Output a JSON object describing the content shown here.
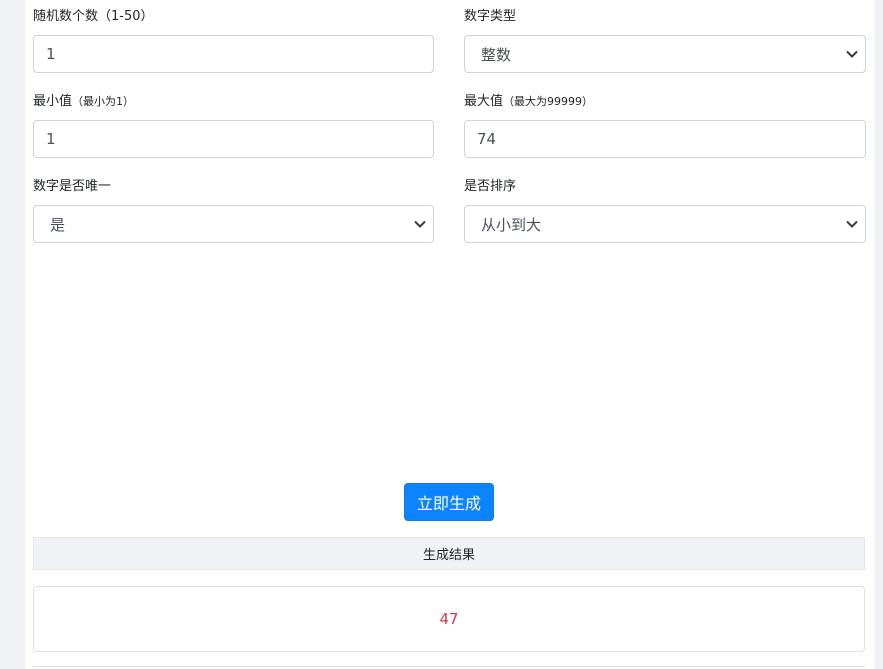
{
  "form": {
    "count": {
      "label": "随机数个数（1-50）",
      "value": "1"
    },
    "type": {
      "label": "数字类型",
      "value": "整数"
    },
    "min": {
      "label": "最小值",
      "hint": "（最小为1）",
      "value": "1"
    },
    "max": {
      "label": "最大值",
      "hint": "（最大为99999）",
      "value": "74"
    },
    "unique": {
      "label": "数字是否唯一",
      "value": "是"
    },
    "sort": {
      "label": "是否排序",
      "value": "从小到大"
    }
  },
  "generate_button": "立即生成",
  "result": {
    "header": "生成结果",
    "value": "47"
  },
  "icons": {
    "select_arrow": "chevron-down-icon"
  },
  "colors": {
    "primary": "#0d84ff",
    "result_text": "#dc3545"
  }
}
